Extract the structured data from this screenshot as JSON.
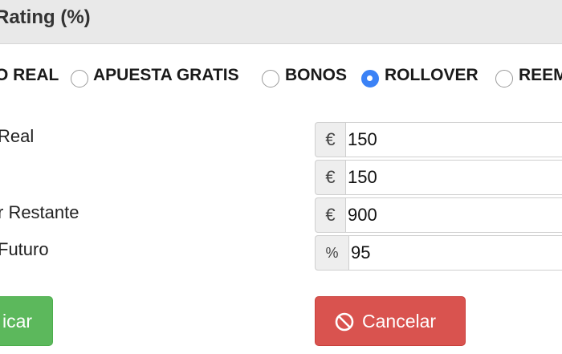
{
  "header": {
    "title": "Rating (%)"
  },
  "bet_types": [
    {
      "label": "O REAL",
      "checked": false
    },
    {
      "label": "APUESTA GRATIS",
      "checked": false
    },
    {
      "label": "BONOS",
      "checked": false
    },
    {
      "label": "ROLLOVER",
      "checked": true
    },
    {
      "label": "REEM",
      "checked": false
    }
  ],
  "fields": [
    {
      "label": "Real",
      "addon": "€",
      "value": "150"
    },
    {
      "label": "",
      "addon": "€",
      "value": "150"
    },
    {
      "label": "r Restante",
      "addon": "€",
      "value": "900"
    },
    {
      "label": "Futuro",
      "addon": "%",
      "value": "95"
    }
  ],
  "buttons": {
    "apply_label": "icar",
    "cancel_label": "Cancelar",
    "cancel_icon": "ban-icon"
  },
  "colors": {
    "header_bg": "#e9e9e9",
    "radio_checked": "#3b82f6",
    "apply_button": "#5cb85c",
    "cancel_button": "#d9534f"
  }
}
